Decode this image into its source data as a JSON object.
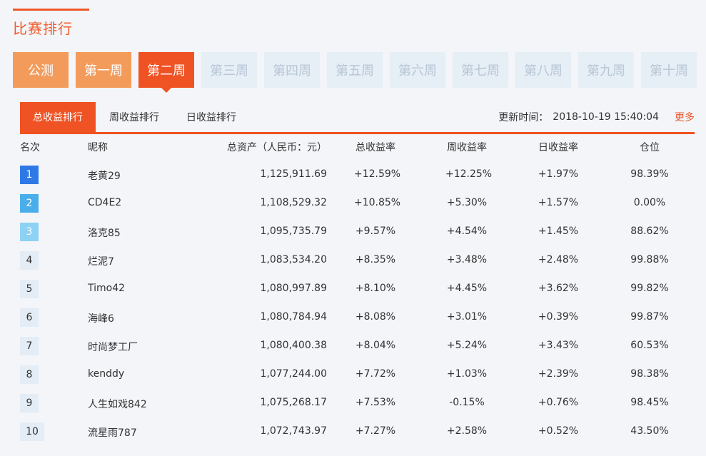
{
  "page": {
    "title": "比赛排行"
  },
  "weeks": [
    {
      "label": "公测",
      "state": "orange"
    },
    {
      "label": "第一周",
      "state": "orange"
    },
    {
      "label": "第二周",
      "state": "active"
    },
    {
      "label": "第三周",
      "state": "disabled"
    },
    {
      "label": "第四周",
      "state": "disabled"
    },
    {
      "label": "第五周",
      "state": "disabled"
    },
    {
      "label": "第六周",
      "state": "disabled"
    },
    {
      "label": "第七周",
      "state": "disabled"
    },
    {
      "label": "第八周",
      "state": "disabled"
    },
    {
      "label": "第九周",
      "state": "disabled"
    },
    {
      "label": "第十周",
      "state": "disabled"
    }
  ],
  "tabs": [
    {
      "label": "总收益排行",
      "active": true
    },
    {
      "label": "周收益排行",
      "active": false
    },
    {
      "label": "日收益排行",
      "active": false
    }
  ],
  "update": {
    "label": "更新时间：",
    "time": "2018-10-19 15:40:04"
  },
  "more": "更多",
  "table": {
    "headers": {
      "rank": "名次",
      "name": "昵称",
      "assets": "总资产（人民币：元）",
      "total": "总收益率",
      "week": "周收益率",
      "day": "日收益率",
      "position": "仓位"
    },
    "rows": [
      {
        "rank": "1",
        "name": "老黄29",
        "assets": "1,125,911.69",
        "total": "+12.59%",
        "week": "+12.25%",
        "day": "+1.97%",
        "position": "98.39%"
      },
      {
        "rank": "2",
        "name": "CD4E2",
        "assets": "1,108,529.32",
        "total": "+10.85%",
        "week": "+5.30%",
        "day": "+1.57%",
        "position": "0.00%"
      },
      {
        "rank": "3",
        "name": "洛克85",
        "assets": "1,095,735.79",
        "total": "+9.57%",
        "week": "+4.54%",
        "day": "+1.45%",
        "position": "88.62%"
      },
      {
        "rank": "4",
        "name": "烂泥7",
        "assets": "1,083,534.20",
        "total": "+8.35%",
        "week": "+3.48%",
        "day": "+2.48%",
        "position": "99.88%"
      },
      {
        "rank": "5",
        "name": "Timo42",
        "assets": "1,080,997.89",
        "total": "+8.10%",
        "week": "+4.45%",
        "day": "+3.62%",
        "position": "99.82%"
      },
      {
        "rank": "6",
        "name": "海峰6",
        "assets": "1,080,784.94",
        "total": "+8.08%",
        "week": "+3.01%",
        "day": "+0.39%",
        "position": "99.87%"
      },
      {
        "rank": "7",
        "name": "时尚梦工厂",
        "assets": "1,080,400.38",
        "total": "+8.04%",
        "week": "+5.24%",
        "day": "+3.43%",
        "position": "60.53%"
      },
      {
        "rank": "8",
        "name": "kenddy",
        "assets": "1,077,244.00",
        "total": "+7.72%",
        "week": "+1.03%",
        "day": "+2.39%",
        "position": "98.38%"
      },
      {
        "rank": "9",
        "name": "人生如戏842",
        "assets": "1,075,268.17",
        "total": "+7.53%",
        "week": "-0.15%",
        "day": "+0.76%",
        "position": "98.45%"
      },
      {
        "rank": "10",
        "name": "流星雨787",
        "assets": "1,072,743.97",
        "total": "+7.27%",
        "week": "+2.58%",
        "day": "+0.52%",
        "position": "43.50%"
      }
    ]
  }
}
